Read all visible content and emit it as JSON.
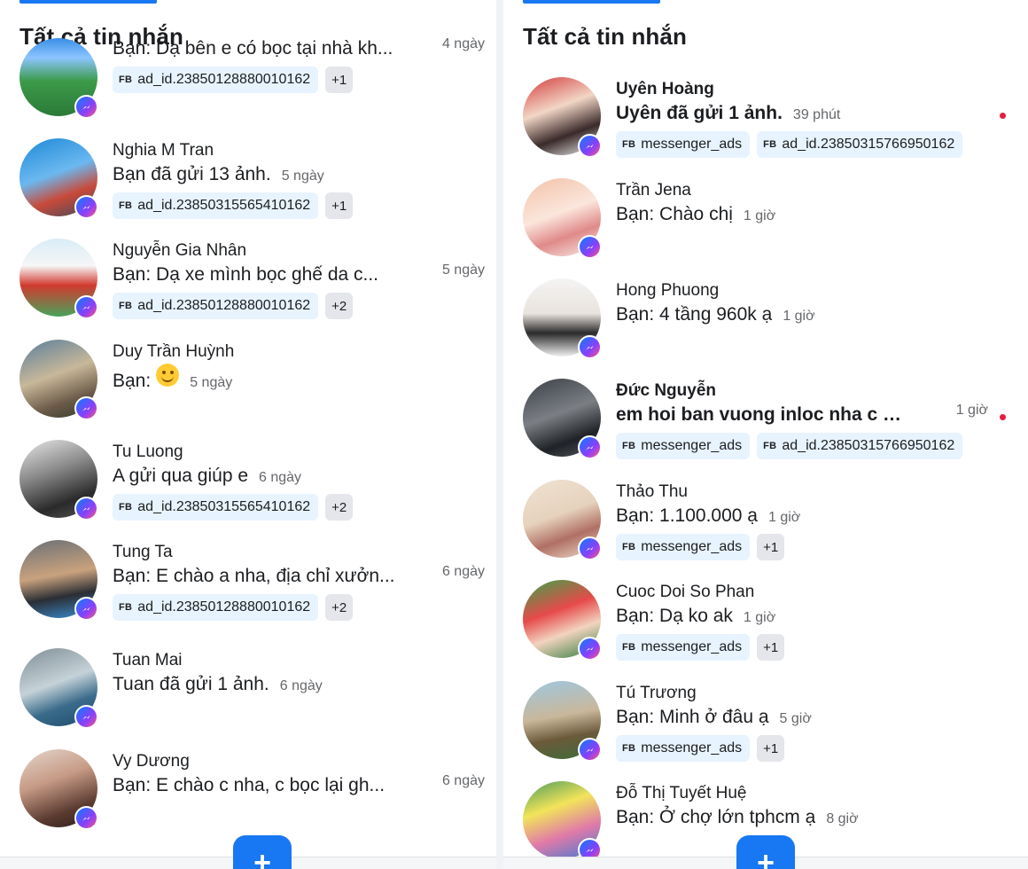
{
  "colors": {
    "accent": "#1877f2",
    "tag_bg": "#e7f3ff",
    "plus_bg": "#e4e6eb",
    "unread_dot": "#e41e3f",
    "muted_text": "#65676b"
  },
  "left": {
    "title": "Tất cả tin nhắn",
    "conversations": [
      {
        "name": "",
        "snippet": "Bạn: Dạ bên e có bọc tại nhà kh...",
        "time": "4 ngày",
        "tags": [
          "ad_id.23850128880010162"
        ],
        "more": "+1"
      },
      {
        "name": "Nghia M Tran",
        "snippet": "Bạn đã gửi 13 ảnh.",
        "time": "5 ngày",
        "tags": [
          "ad_id.23850315565410162"
        ],
        "more": "+1"
      },
      {
        "name": "Nguyễn Gia Nhân",
        "snippet": "Bạn: Dạ xe mình bọc ghế da c...",
        "time": "5 ngày",
        "tags": [
          "ad_id.23850128880010162"
        ],
        "more": "+2"
      },
      {
        "name": "Duy Trần Huỳnh",
        "snippet": "Bạn:",
        "time": "5 ngày",
        "emoji": "smiling-face-emoji"
      },
      {
        "name": "Tu Luong",
        "snippet": "A gửi qua giúp e",
        "time": "6 ngày",
        "tags": [
          "ad_id.23850315565410162"
        ],
        "more": "+2"
      },
      {
        "name": "Tung Ta",
        "snippet": "Bạn: E chào a nha, địa chỉ xưởn...",
        "time": "6 ngày",
        "tags": [
          "ad_id.23850128880010162"
        ],
        "more": "+2"
      },
      {
        "name": "Tuan Mai",
        "snippet": "Tuan đã gửi 1 ảnh.",
        "time": "6 ngày"
      },
      {
        "name": "Vy Dương",
        "snippet": "Bạn: E chào c nha, c bọc lại gh...",
        "time": "6 ngày"
      }
    ],
    "fab_label": "+"
  },
  "right": {
    "title": "Tất cả tin nhắn",
    "conversations": [
      {
        "name": "Uyên Hoàng",
        "snippet": "Uyên đã gửi 1 ảnh.",
        "time": "39 phút",
        "tags": [
          "messenger_ads",
          "ad_id.23850315766950162"
        ],
        "unread": true
      },
      {
        "name": "Trần Jena",
        "snippet": "Bạn: Chào chị",
        "time": "1 giờ"
      },
      {
        "name": "Hong Phuong",
        "snippet": "Bạn: 4 tầng 960k ạ",
        "time": "1 giờ"
      },
      {
        "name": "Đức Nguyễn",
        "snippet": "em hoi ban vuong inloc nha c oi g...",
        "time": "1 giờ",
        "tags": [
          "messenger_ads",
          "ad_id.23850315766950162"
        ],
        "unread": true
      },
      {
        "name": "Thảo Thu",
        "snippet": "Bạn: 1.100.000 ạ",
        "time": "1 giờ",
        "tags": [
          "messenger_ads"
        ],
        "more": "+1"
      },
      {
        "name": "Cuoc Doi So Phan",
        "snippet": "Bạn: Dạ ko ak",
        "time": "1 giờ",
        "tags": [
          "messenger_ads"
        ],
        "more": "+1"
      },
      {
        "name": "Tú Trương",
        "snippet": "Bạn: Minh ở đâu ạ",
        "time": "5 giờ",
        "tags": [
          "messenger_ads"
        ],
        "more": "+1"
      },
      {
        "name": "Đỗ Thị Tuyết Huệ",
        "snippet": "Bạn: Ở chợ lớn tphcm ạ",
        "time": "8 giờ"
      }
    ],
    "fab_label": "+"
  },
  "tag_prefix": "FB"
}
